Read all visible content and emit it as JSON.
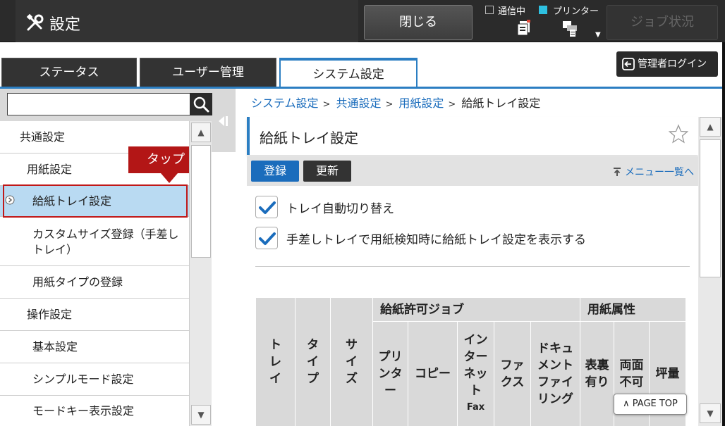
{
  "topbar": {
    "title": "設定",
    "close_label": "閉じる",
    "status_comm_label": "通信中",
    "status_printer_label": "プリンター",
    "job_status_label": "ジョブ状況",
    "settings_icon": "tools-icon",
    "printer_indicator_color": "#2ec0e0"
  },
  "tabs": [
    {
      "label": "ステータス"
    },
    {
      "label": "ユーザー管理"
    },
    {
      "label": "システム設定"
    }
  ],
  "admin_login_label": "管理者ログイン",
  "sidebar": {
    "search_placeholder": "",
    "items": [
      {
        "label": "共通設定"
      },
      {
        "label": "用紙設定"
      },
      {
        "label": "給紙トレイ設定"
      },
      {
        "label": "カスタムサイズ登録（手差しトレイ）"
      },
      {
        "label": "用紙タイプの登録"
      },
      {
        "label": "操作設定"
      },
      {
        "label": "基本設定"
      },
      {
        "label": "シンプルモード設定"
      },
      {
        "label": "モードキー表示設定"
      }
    ],
    "callout_label": "タップ"
  },
  "breadcrumb": {
    "items": [
      "システム設定",
      "共通設定",
      "用紙設定"
    ],
    "separator": ">",
    "current": "給紙トレイ設定"
  },
  "main": {
    "page_title": "給紙トレイ設定",
    "register_label": "登録",
    "update_label": "更新",
    "menu_list_link": "メニュー一覧へ",
    "checkboxes": [
      {
        "label": "トレイ自動切り替え",
        "checked": true
      },
      {
        "label": "手差しトレイで用紙検知時に給紙トレイ設定を表示する",
        "checked": true
      }
    ],
    "table": {
      "col_tray": "トレイ",
      "col_type": "タイプ",
      "col_size": "サイズ",
      "group_jobs": "給紙許可ジョブ",
      "group_attributes": "用紙属性",
      "col_printer": "プリンター",
      "col_copy": "コピー",
      "col_internet_fax_1": "インターネット",
      "col_internet_fax_2": "Fax",
      "col_fax": "ファクス",
      "col_document_filing": "ドキュメントファイリング",
      "col_duplex_ok": "表裏有り",
      "col_duplex_ng": "両面不可",
      "col_weight": "坪量"
    },
    "page_top_label": "PAGE TOP"
  }
}
